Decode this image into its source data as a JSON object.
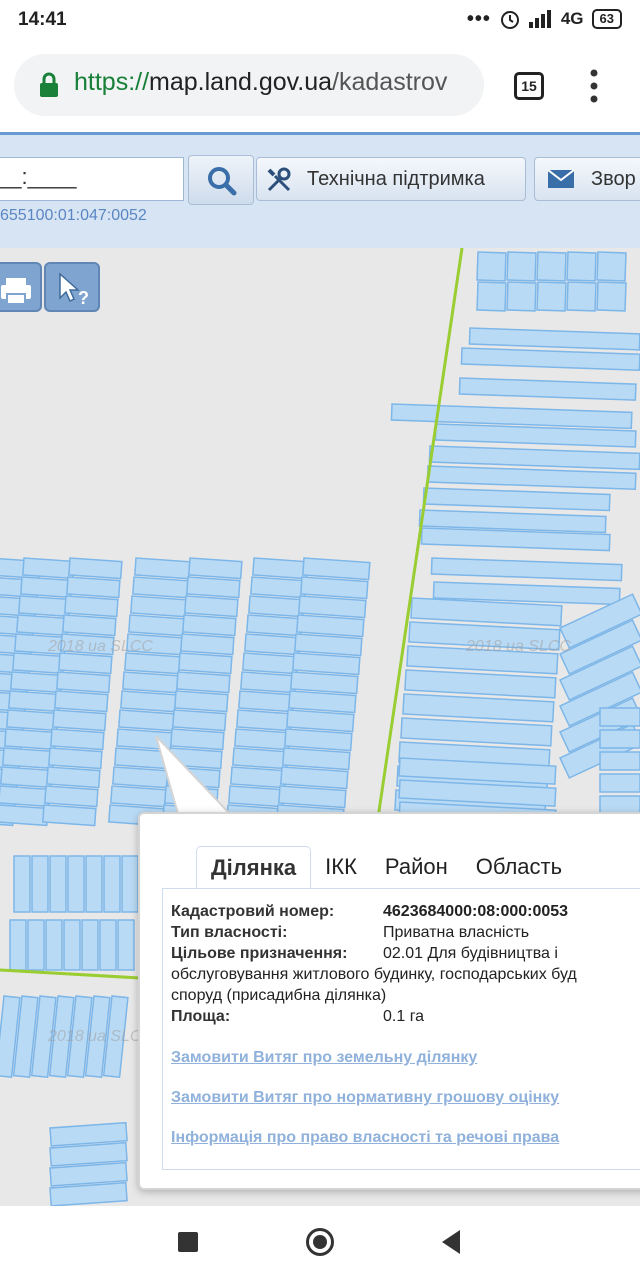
{
  "status_bar": {
    "time": "14:41",
    "network": "4G",
    "battery": "63"
  },
  "browser": {
    "url_scheme": "https://",
    "url_host": "map.land.gov.ua",
    "url_path": "/kadastrov",
    "tab_count": "15"
  },
  "header": {
    "search_value": "__:____",
    "support_label": "Технічна підтримка",
    "feedback_label": "Звор",
    "cadastral_hint": "655100:01:047:0052"
  },
  "map": {
    "watermark": "2018 ua SLCC"
  },
  "popup": {
    "tabs": [
      "Ділянка",
      "ІКК",
      "Район",
      "Область"
    ],
    "active_tab": "Ділянка",
    "fields": {
      "cadastral_label": "Кадастровий номер:",
      "cadastral_value": "4623684000:08:000:0053",
      "ownership_label": "Тип власності:",
      "ownership_value": "Приватна власність",
      "purpose_label": "Цільове призначення:",
      "purpose_value_1": "02.01 Для будівництва і",
      "purpose_value_2": "обслуговування житлового будинку, господарських буд",
      "purpose_value_3": "споруд (присадибна ділянка)",
      "area_label": "Площа:",
      "area_value": "0.1 га"
    },
    "links": [
      "Замовити Витяг про земельну ділянку",
      "Замовити Витяг про нормативну грошову оцінку",
      "Інформація про право власності та речові права"
    ]
  },
  "colors": {
    "parcel_fill": "#b9daf5",
    "parcel_stroke": "#7db6e8",
    "boundary_line": "#9acd32",
    "link": "#8fb1db"
  }
}
